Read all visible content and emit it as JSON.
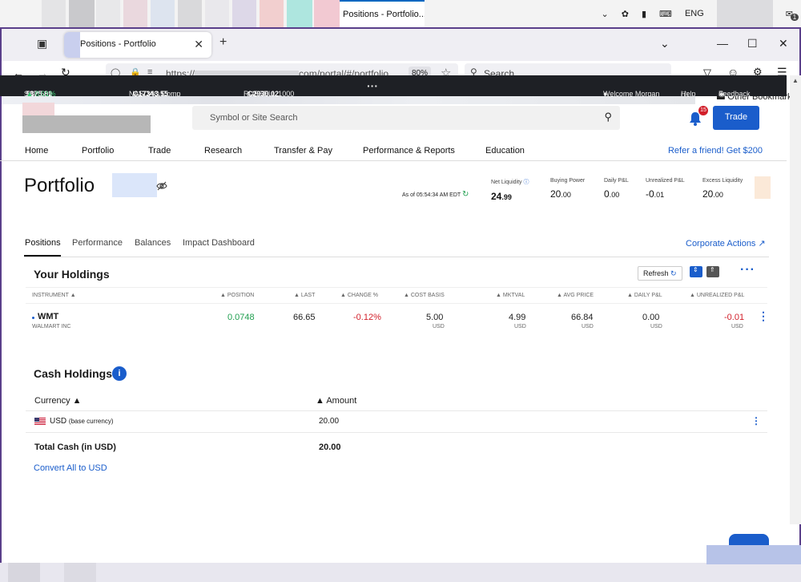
{
  "colors": {
    "accent": "#1a5dcb",
    "positive": "#1e9e4e",
    "negative": "#d21f2a",
    "ticker_bg": "#1e2025"
  },
  "os": {
    "active_tab_title": "Positions - Portfolio...",
    "tray_language": "ENG",
    "tray_badge": "1"
  },
  "browser": {
    "tab_title": "Positions - Portfolio",
    "url_prefix": "https://",
    "url_suffix": "com/portal/#/portfolio",
    "zoom": "80%",
    "search_placeholder": "Search",
    "other_bookmarks": "Other Bookmarks"
  },
  "ticker": {
    "sp_label": "S&P 500",
    "sp_value": "5375.81",
    "sp_change": "▲ 0.01%",
    "nasdaq_label": "NASDAQ Comp",
    "nasdaq_value": "C17343.55",
    "nasdaq_change": "—",
    "russell_label": "RUSSELL 1000",
    "russell_value": "C2930.02",
    "russell_change": "—",
    "welcome": "Welcome Morgan",
    "help": "Help",
    "feedback": "Feedback"
  },
  "header": {
    "search_placeholder": "Symbol or Site Search",
    "notification_count": "15",
    "trade": "Trade",
    "refer": "Refer a friend! Get $200"
  },
  "nav": {
    "items": [
      "Home",
      "Portfolio",
      "Trade",
      "Research",
      "Transfer & Pay",
      "Performance & Reports",
      "Education"
    ]
  },
  "portfolio": {
    "title": "Portfolio",
    "as_of": "As of 05:54:34 AM EDT",
    "metrics": [
      {
        "label": "Net Liquidity",
        "value": "24",
        "decimals": ".99"
      },
      {
        "label": "Buying Power",
        "value": "20",
        "decimals": ".00"
      },
      {
        "label": "Daily P&L",
        "value": "0",
        "decimals": ".00"
      },
      {
        "label": "Unrealized P&L",
        "value": "-0",
        "decimals": ".01"
      },
      {
        "label": "Excess Liquidity",
        "value": "20",
        "decimals": ".00"
      }
    ],
    "subtabs": [
      "Positions",
      "Performance",
      "Balances",
      "Impact Dashboard"
    ],
    "corporate_actions": "Corporate Actions ↗"
  },
  "holdings": {
    "title": "Your Holdings",
    "refresh": "Refresh",
    "columns": [
      "INSTRUMENT ▲",
      "▲ POSITION",
      "▲ LAST",
      "▲ CHANGE %",
      "▲ COST BASIS",
      "▲ MKTVAL",
      "▲ AVG PRICE",
      "▲ DAILY P&L",
      "▲ UNREALIZED P&L"
    ],
    "row": {
      "symbol": "WMT",
      "name": "WALMART INC",
      "position": "0.0748",
      "last": "66.65",
      "change": "-0.12%",
      "cost_basis": "5.00",
      "mktval": "4.99",
      "avg_price": "66.84",
      "daily_pnl": "0.00",
      "unrealized_pnl": "-0.01",
      "unit": "USD"
    }
  },
  "cash": {
    "title": "Cash Holdings",
    "info_icon": "i",
    "col_currency": "Currency ▲",
    "col_amount": "▲ Amount",
    "currency": "USD",
    "currency_note": "(base currency)",
    "amount": "20.00",
    "total_label": "Total Cash (in USD)",
    "total_amount": "20.00",
    "convert": "Convert All to USD"
  }
}
